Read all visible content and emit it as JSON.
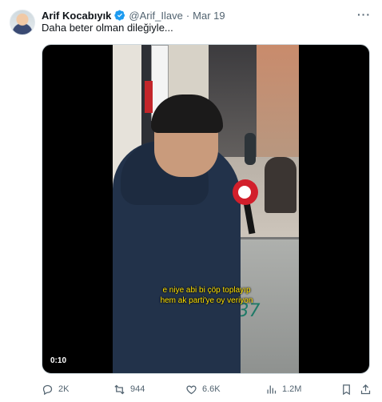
{
  "tweet": {
    "author_name": "Arif Kocabıyık",
    "handle": "@Arif_Ilave",
    "separator": "·",
    "date": "Mar 19",
    "text": "Daha beter olman dileğiyle...",
    "more_icon": "ellipsis-icon",
    "verified_color": "#1d9bf0"
  },
  "video": {
    "subtitle_line1": "e niye abi bi çöp toplayıp",
    "subtitle_line2": "hem ak parti'ye oy veriyon",
    "graffiti": "J37",
    "timer": "0:10",
    "subtitle_color": "#ffe100"
  },
  "actions": {
    "replies": "2K",
    "retweets": "944",
    "likes": "6.6K",
    "views": "1.2M"
  }
}
